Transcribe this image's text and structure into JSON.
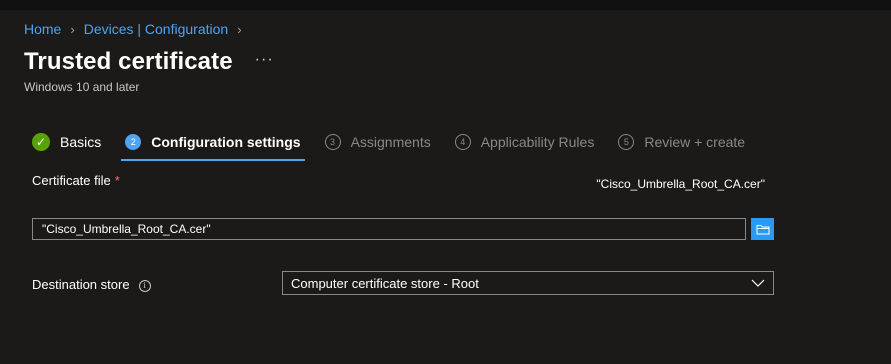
{
  "breadcrumb": {
    "items": [
      "Home",
      "Devices | Configuration"
    ]
  },
  "header": {
    "title": "Trusted certificate",
    "more": "···",
    "subtitle": "Windows 10 and later"
  },
  "steps": [
    {
      "number": "✓",
      "label": "Basics",
      "state": "done"
    },
    {
      "number": "2",
      "label": "Configuration settings",
      "state": "current"
    },
    {
      "number": "3",
      "label": "Assignments",
      "state": "future"
    },
    {
      "number": "4",
      "label": "Applicability Rules",
      "state": "future"
    },
    {
      "number": "5",
      "label": "Review + create",
      "state": "future"
    }
  ],
  "form": {
    "certificate_file": {
      "label": "Certificate file",
      "required_mark": "*",
      "selected_file": "\"Cisco_Umbrella_Root_CA.cer\"",
      "input_value": "\"Cisco_Umbrella_Root_CA.cer\""
    },
    "destination_store": {
      "label": "Destination store",
      "info": "i",
      "selected_value": "Computer certificate store - Root"
    }
  },
  "icons": {
    "breadcrumb_separator": "chevron-right-icon",
    "browse": "folder-icon",
    "dropdown": "chevron-down-icon",
    "info": "info-icon",
    "completed_step": "checkmark-icon"
  },
  "colors": {
    "background": "#1b1a19",
    "accent": "#4fa3f0",
    "success": "#57a300",
    "required": "#f1707b",
    "browse_button": "#2899f5"
  }
}
